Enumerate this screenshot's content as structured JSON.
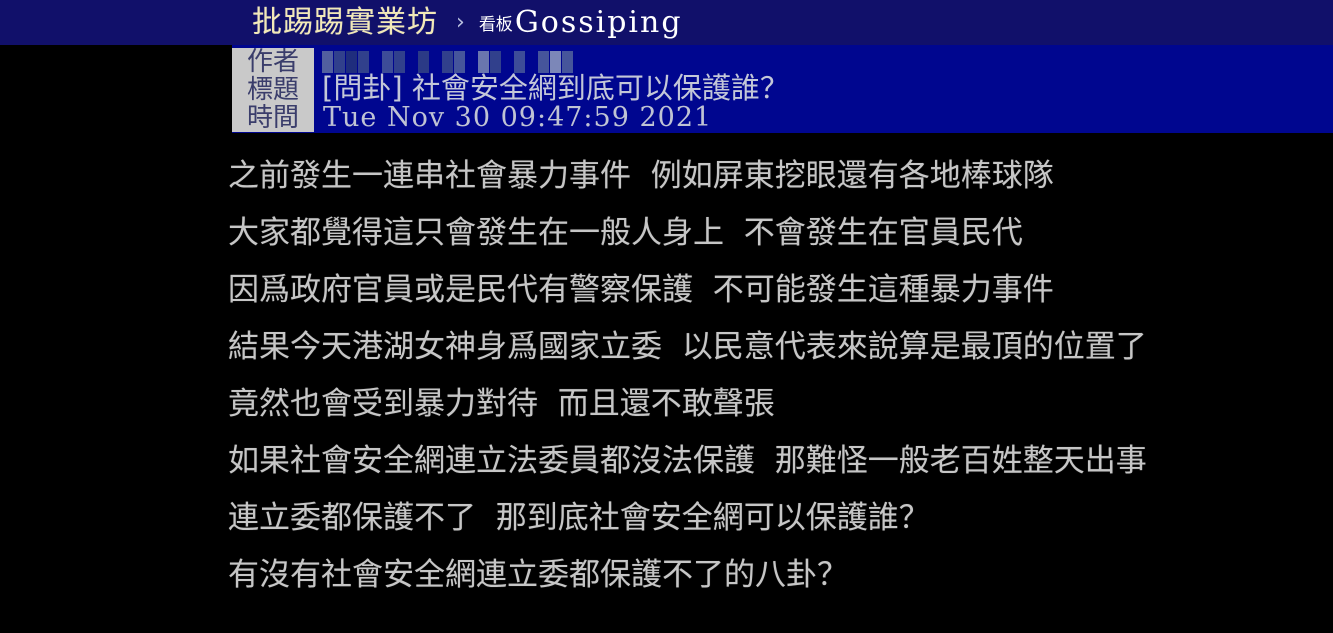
{
  "breadcrumb": {
    "root_label": "批踢踢實業坊",
    "separator": "›",
    "board_prefix": "看板",
    "board_name": "Gossiping"
  },
  "meta": {
    "labels": {
      "author": "作者",
      "title": "標題",
      "time": "時間"
    },
    "author_value": "",
    "author_redacted": true,
    "title_value": "[問卦] 社會安全網到底可以保護誰？",
    "time_value": "Tue Nov 30 09:47:59 2021"
  },
  "post": {
    "lines": [
      "之前發生一連串社會暴力事件  例如屏東挖眼還有各地棒球隊",
      "大家都覺得這只會發生在一般人身上  不會發生在官員民代",
      "因爲政府官員或是民代有警察保護  不可能發生這種暴力事件",
      "結果今天港湖女神身爲國家立委  以民意代表來說算是最頂的位置了",
      "竟然也會受到暴力對待  而且還不敢聲張",
      "如果社會安全網連立法委員都沒法保護  那難怪一般老百姓整天出事",
      "連立委都保護不了  那到底社會安全網可以保護誰？",
      "有沒有社會安全網連立委都保護不了的八卦？"
    ]
  },
  "colors": {
    "page_background": "#000000",
    "topbar_background": "#11106a",
    "meta_background": "#00068f",
    "meta_label_background": "#c9c9c9",
    "root_label_color": "#f2e9b8",
    "body_text_color": "#c6c6c6"
  }
}
